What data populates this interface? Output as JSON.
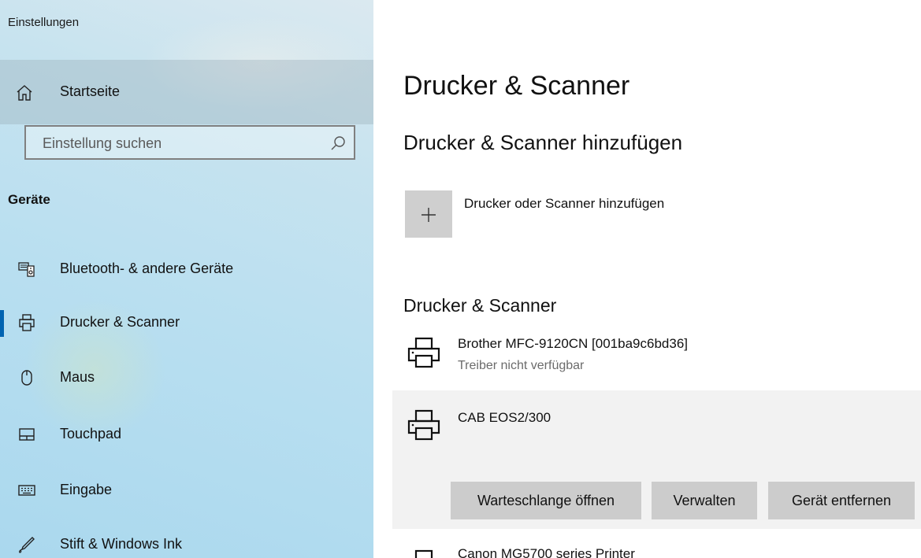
{
  "window": {
    "title": "Einstellungen"
  },
  "sidebar": {
    "home_label": "Startseite",
    "search": {
      "placeholder": "Einstellung suchen"
    },
    "group_label": "Geräte",
    "items": [
      {
        "label": "Bluetooth- & andere Geräte",
        "icon": "bluetooth-devices-icon"
      },
      {
        "label": "Drucker & Scanner",
        "icon": "printer-icon",
        "active": true
      },
      {
        "label": "Maus",
        "icon": "mouse-icon"
      },
      {
        "label": "Touchpad",
        "icon": "touchpad-icon"
      },
      {
        "label": "Eingabe",
        "icon": "keyboard-icon"
      },
      {
        "label": "Stift & Windows Ink",
        "icon": "pen-icon"
      }
    ]
  },
  "main": {
    "title": "Drucker & Scanner",
    "add_section_title": "Drucker & Scanner hinzufügen",
    "add_button_label": "Drucker oder Scanner hinzufügen",
    "list_section_title": "Drucker & Scanner",
    "devices": [
      {
        "name": "Brother MFC-9120CN [001ba9c6bd36]",
        "status": "Treiber nicht verfügbar"
      },
      {
        "name": "CAB EOS2/300",
        "status": "",
        "selected": true
      },
      {
        "name": "Canon MG5700 series Printer",
        "status": ""
      }
    ],
    "actions": {
      "open_queue": "Warteschlange öffnen",
      "manage": "Verwalten",
      "remove": "Gerät entfernen"
    }
  },
  "colors": {
    "accent": "#0063b1",
    "button": "#cccccc",
    "selected_row": "#f2f2f2"
  }
}
